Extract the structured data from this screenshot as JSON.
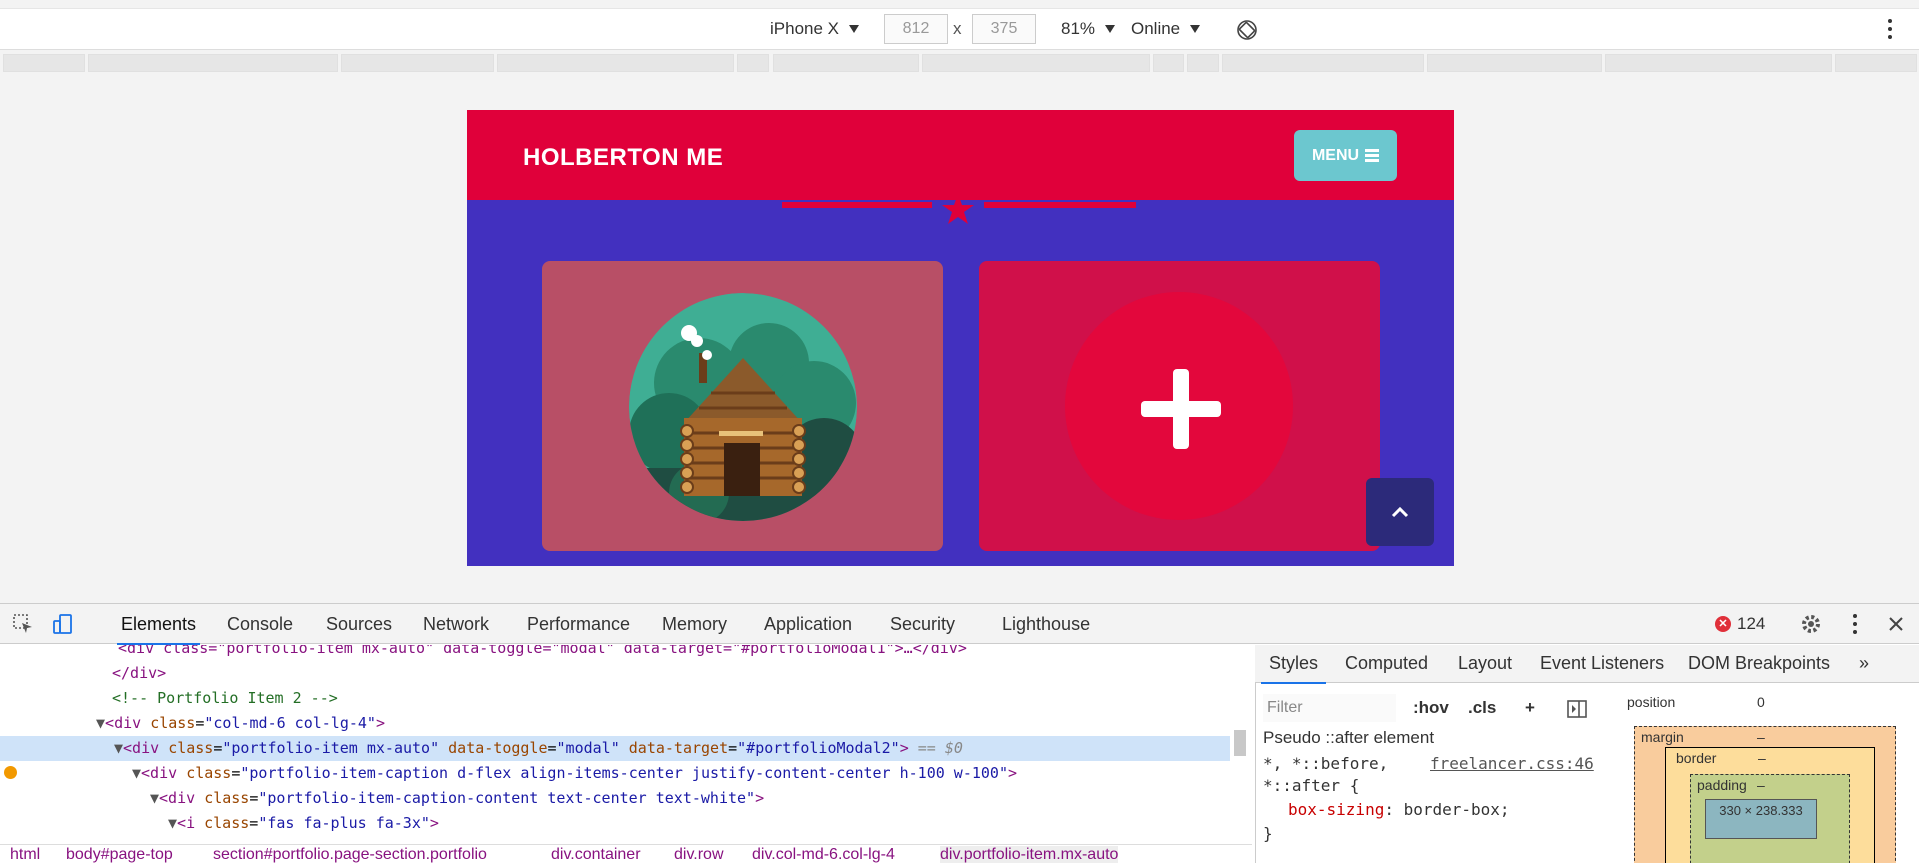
{
  "device_bar": {
    "device": "iPhone X",
    "width": "812",
    "height": "375",
    "times": "x",
    "zoom": "81%",
    "network": "Online"
  },
  "site": {
    "brand": "HOLBERTON ME",
    "menu_label": "MENU",
    "colors": {
      "nav": "#e0003a",
      "body": "#4230bf",
      "accent": "#6cc7cf"
    }
  },
  "devtools": {
    "tabs": [
      "Elements",
      "Console",
      "Sources",
      "Network",
      "Performance",
      "Memory",
      "Application",
      "Security",
      "Lighthouse"
    ],
    "error_count": "124",
    "styles_tabs": [
      "Styles",
      "Computed",
      "Layout",
      "Event Listeners",
      "DOM Breakpoints"
    ],
    "more_tabs": "»",
    "filter_placeholder": "Filter",
    "hov": ":hov",
    "cls": ".cls",
    "plus": "+",
    "pseudo_heading": "Pseudo ::after element",
    "rule_selector_1": "*, *::before,",
    "rule_selector_2": "*::after {",
    "rule_prop": "box-sizing",
    "rule_val": "border-box;",
    "rule_close": "}",
    "rule_source": "freelancer.css:46",
    "box_model": {
      "position_label": "position",
      "position_value": "0",
      "margin_label": "margin",
      "margin_value": "–",
      "border_label": "border",
      "border_value": "–",
      "padding_label": "padding",
      "padding_value": "–",
      "content_size": "330 × 238.333"
    },
    "code": {
      "line0_partial": "div class=\"portfolio-item mx-auto\" data-toggle=\"modal\" data-target=\"#portfolioModal1\">…</div>",
      "line1": "</div>",
      "line2_comment": "<!-- Portfolio Item 2 -->",
      "line3_tag": "div",
      "line3_attr": "class",
      "line3_val": "\"col-md-6 col-lg-4\"",
      "line4_attr1": "class",
      "line4_val1": "\"portfolio-item mx-auto\"",
      "line4_attr2": "data-toggle",
      "line4_val2": "\"modal\"",
      "line4_attr3": "data-target",
      "line4_val3": "\"#portfolioModal2\"",
      "line4_suffix": "== $0",
      "line5_attr": "class",
      "line5_val": "\"portfolio-item-caption d-flex align-items-center justify-content-center h-100 w-100\"",
      "line6_attr": "class",
      "line6_val": "\"portfolio-item-caption-content text-center text-white\"",
      "line7_tag": "i",
      "line7_attr": "class",
      "line7_val": "\"fas fa-plus fa-3x\""
    },
    "breadcrumbs": [
      "html",
      "body#page-top",
      "section#portfolio.page-section.portfolio",
      "div.container",
      "div.row",
      "div.col-md-6.col-lg-4",
      "div.portfolio-item.mx-auto"
    ]
  }
}
